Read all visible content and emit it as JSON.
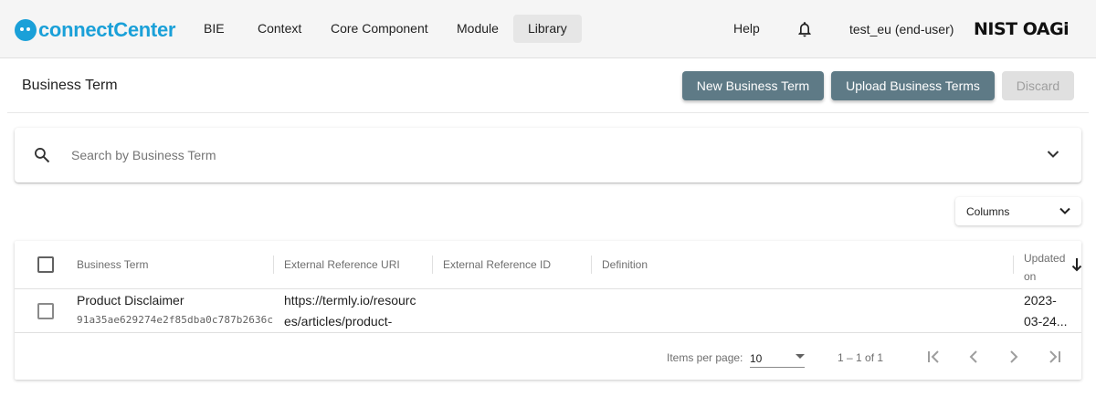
{
  "app": {
    "logo_a": "connect",
    "logo_b": "Center",
    "partner_logo": "NIST OAGi"
  },
  "nav": {
    "items": [
      "BIE",
      "Context",
      "Core Component",
      "Module",
      "Library"
    ],
    "active": "Library",
    "help": "Help",
    "user": "test_eu (end-user)"
  },
  "page": {
    "title": "Business Term",
    "new_button": "New Business Term",
    "upload_button": "Upload Business Terms",
    "discard_button": "Discard"
  },
  "search": {
    "placeholder": "Search by Business Term",
    "value": ""
  },
  "columns_button": "Columns",
  "table": {
    "headers": [
      "Business Term",
      "External Reference URI",
      "External Reference ID",
      "Definition",
      "Updated on"
    ],
    "updated_header_line1": "Updated",
    "updated_header_line2": "on",
    "rows": [
      {
        "term": "Product Disclaimer",
        "guid": "91a35ae629274e2f85dba0c787b2636c",
        "uri_line1": "https://termly.io/resourc",
        "uri_line2": "es/articles/product-",
        "external_id": "",
        "definition": "",
        "updated_line1": "2023-",
        "updated_line2": "03-24..."
      }
    ]
  },
  "paginator": {
    "items_per_page_label": "Items per page:",
    "page_size": "10",
    "range": "1 – 1 of 1"
  },
  "colors": {
    "primary_button": "#5e7a86",
    "logo_blue": "#1aa0d8",
    "topbar": "#f5f5f5"
  }
}
